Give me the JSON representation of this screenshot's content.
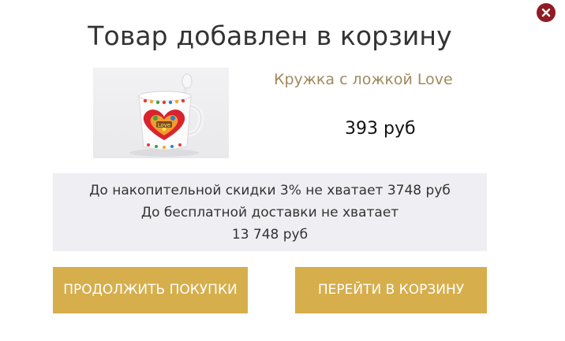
{
  "modal": {
    "title": "Товар добавлен в корзину",
    "close_icon": "close-icon"
  },
  "product": {
    "name": "Кружка с ложкой Love",
    "price": "393 руб",
    "image_icon": "mug-with-spoon-photo",
    "mug_text": "Love"
  },
  "info": {
    "line1": "До накопительной скидки 3% не хватает 3748 руб",
    "line2": "До бесплатной доставки не хватает",
    "line3": "13 748 руб"
  },
  "buttons": {
    "continue_label": "ПРОДОЛЖИТЬ ПОКУПКИ",
    "cart_label": "ПЕРЕЙТИ В КОРЗИНУ"
  },
  "colors": {
    "close_bg": "#8f1b24",
    "accent_gold": "#d6ae4b",
    "product_name": "#a08a5d",
    "info_bg": "#efeff3"
  }
}
